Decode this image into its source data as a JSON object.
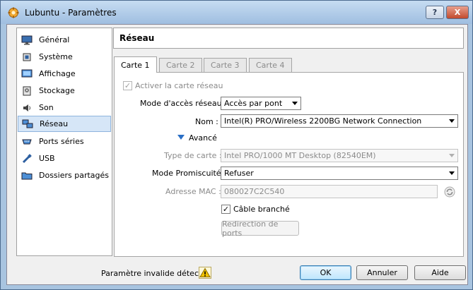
{
  "window": {
    "title": "Lubuntu - Paramètres",
    "help_label": "?",
    "close_label": "X"
  },
  "sidebar": {
    "items": [
      {
        "label": "Général",
        "icon": "monitor-icon"
      },
      {
        "label": "Système",
        "icon": "chip-icon"
      },
      {
        "label": "Affichage",
        "icon": "display-icon"
      },
      {
        "label": "Stockage",
        "icon": "storage-icon"
      },
      {
        "label": "Son",
        "icon": "speaker-icon"
      },
      {
        "label": "Réseau",
        "icon": "network-icon",
        "selected": true
      },
      {
        "label": "Ports séries",
        "icon": "serial-port-icon"
      },
      {
        "label": "USB",
        "icon": "usb-icon"
      },
      {
        "label": "Dossiers partagés",
        "icon": "folder-icon"
      }
    ]
  },
  "page": {
    "title": "Réseau",
    "tabs": [
      "Carte 1",
      "Carte 2",
      "Carte 3",
      "Carte 4"
    ],
    "active_tab": "Carte 1",
    "enable_adapter": {
      "label": "Activer la carte réseau",
      "checked": true,
      "enabled": false
    },
    "access_mode": {
      "label": "Mode d'accès réseau :",
      "value": "Accès par pont"
    },
    "name": {
      "label": "Nom :",
      "value": "Intel(R) PRO/Wireless 2200BG Network Connection"
    },
    "advanced": {
      "label": "Avancé"
    },
    "adapter_type": {
      "label": "Type de carte :",
      "value": "Intel PRO/1000 MT Desktop (82540EM)"
    },
    "promiscuous": {
      "label": "Mode Promiscuité :",
      "value": "Refuser"
    },
    "mac": {
      "label": "Adresse MAC :",
      "value": "080027C2C540"
    },
    "cable": {
      "label": "Câble branché",
      "checked": true
    },
    "port_forwarding": {
      "label": "Redirection de ports"
    }
  },
  "footer": {
    "status": "Paramètre invalide détecté",
    "ok": "OK",
    "cancel": "Annuler",
    "help": "Aide"
  },
  "colors": {
    "title_bg": "#b3cde8",
    "selected_bg": "#d6e6f7",
    "warning": "#f2c200"
  }
}
